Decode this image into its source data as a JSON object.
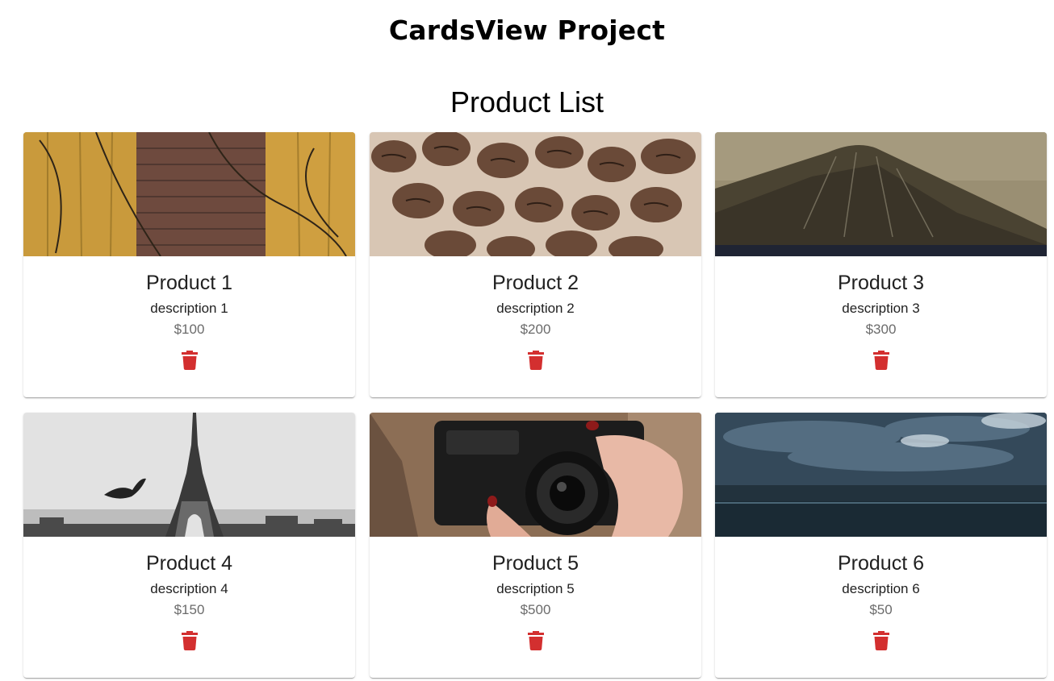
{
  "header": {
    "app_title": "CardsView Project"
  },
  "main": {
    "list_title": "Product List",
    "delete_icon": "trash-icon",
    "delete_color": "#d32f2f",
    "products": [
      {
        "name": "Product 1",
        "description": "description 1",
        "price": "$100",
        "image": "ivy-brick-wall"
      },
      {
        "name": "Product 2",
        "description": "description 2",
        "price": "$200",
        "image": "coffee-beans"
      },
      {
        "name": "Product 3",
        "description": "description 3",
        "price": "$300",
        "image": "mountain-peak"
      },
      {
        "name": "Product 4",
        "description": "description 4",
        "price": "$150",
        "image": "eiffel-tower-bird"
      },
      {
        "name": "Product 5",
        "description": "description 5",
        "price": "$500",
        "image": "camera-in-hand"
      },
      {
        "name": "Product 6",
        "description": "description 6",
        "price": "$50",
        "image": "stormy-sky"
      }
    ]
  }
}
